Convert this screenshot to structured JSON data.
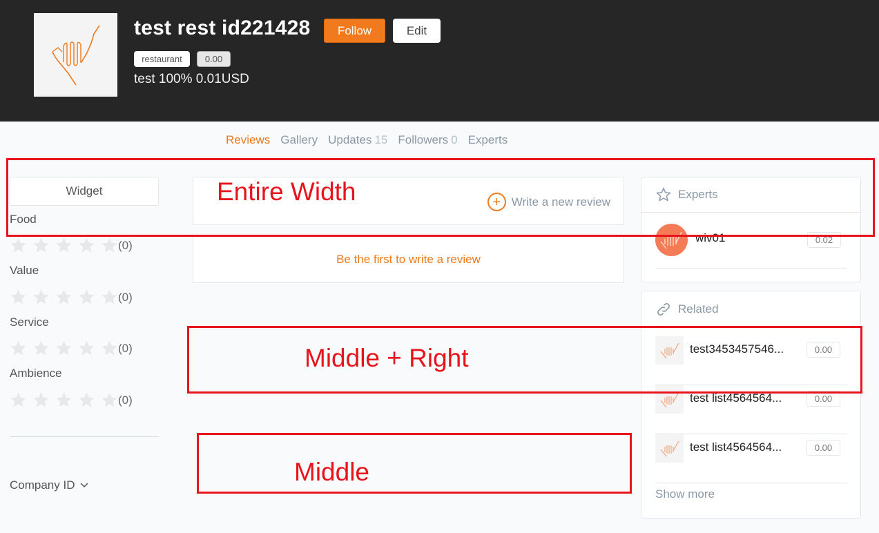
{
  "header": {
    "title": "test rest id221428",
    "follow_label": "Follow",
    "edit_label": "Edit",
    "category_tag": "restaurant",
    "score_tag": "0.00",
    "subline": "test 100% 0.01USD"
  },
  "tabs": [
    {
      "label": "Reviews",
      "count": ""
    },
    {
      "label": "Gallery",
      "count": ""
    },
    {
      "label": "Updates",
      "count": "15"
    },
    {
      "label": "Followers",
      "count": "0"
    },
    {
      "label": "Experts",
      "count": ""
    }
  ],
  "left": {
    "widget_label": "Widget",
    "ratings": [
      {
        "label": "Food",
        "count": "(0)"
      },
      {
        "label": "Value",
        "count": "(0)"
      },
      {
        "label": "Service",
        "count": "(0)"
      },
      {
        "label": "Ambience",
        "count": "(0)"
      }
    ],
    "company_id_label": "Company ID"
  },
  "middle": {
    "write_review_label": "Write a new review",
    "first_review_label": "Be the first to write a review"
  },
  "experts_panel": {
    "title": "Experts",
    "items": [
      {
        "name": "wiv01",
        "score": "0.02"
      }
    ]
  },
  "related_panel": {
    "title": "Related",
    "items": [
      {
        "name": "test3453457546...",
        "score": "0.00"
      },
      {
        "name": "test list4564564...",
        "score": "0.00"
      },
      {
        "name": "test list4564564...",
        "score": "0.00"
      }
    ],
    "show_more_label": "Show more"
  },
  "annotations": {
    "entire_width": "Entire Width",
    "middle_right": "Middle + Right",
    "middle": "Middle"
  },
  "colors": {
    "accent": "#ee7a1c",
    "header_bg": "#262626",
    "annotation": "#e8141b",
    "muted_text": "#8a98a6"
  }
}
